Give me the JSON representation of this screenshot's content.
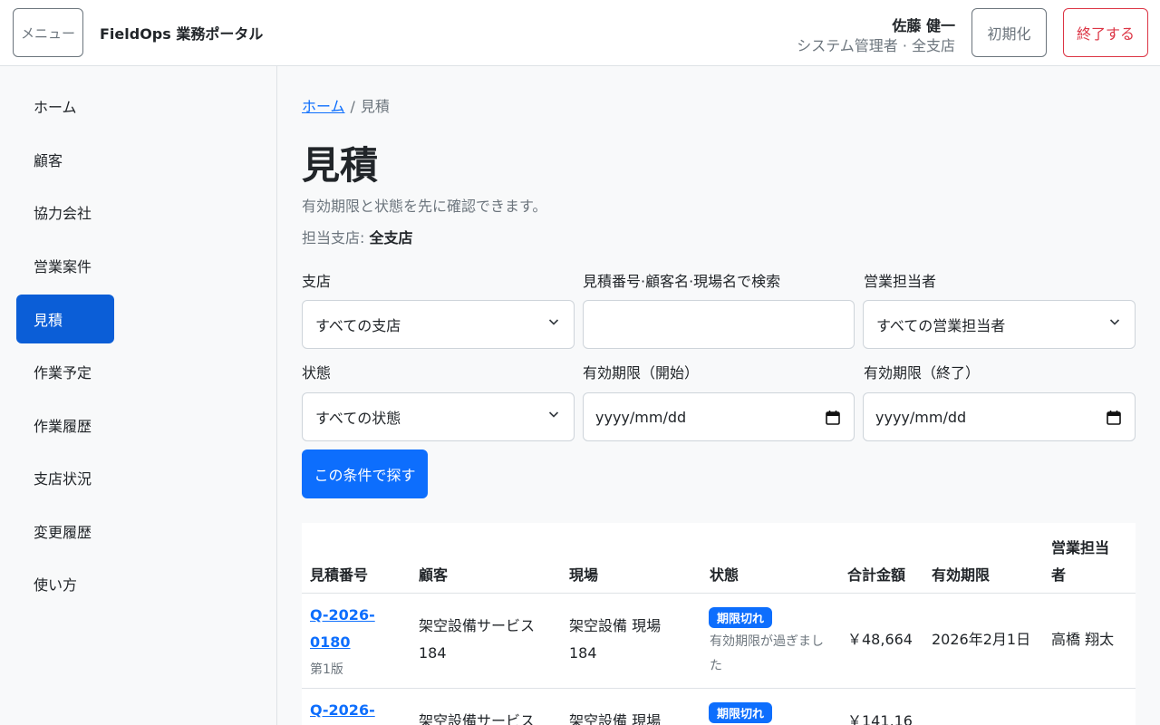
{
  "header": {
    "menu_label": "メニュー",
    "app_title": "FieldOps 業務ポータル",
    "user_name": "佐藤 健一",
    "user_role": "システム管理者 · 全支店",
    "reset_label": "初期化",
    "logout_label": "終了する"
  },
  "sidebar": {
    "items": [
      {
        "label": "ホーム"
      },
      {
        "label": "顧客"
      },
      {
        "label": "協力会社"
      },
      {
        "label": "営業案件"
      },
      {
        "label": "見積",
        "active": true
      },
      {
        "label": "作業予定"
      },
      {
        "label": "作業履歴"
      },
      {
        "label": "支店状況"
      },
      {
        "label": "変更履歴"
      },
      {
        "label": "使い方"
      }
    ]
  },
  "breadcrumb": {
    "home": "ホーム",
    "separator": "/",
    "current": "見積"
  },
  "page": {
    "title": "見積",
    "subtitle": "有効期限と状態を先に確認できます。",
    "branch_prefix": "担当支店:",
    "branch_value": "全支店"
  },
  "filters": {
    "branch_label": "支店",
    "branch_value": "すべての支店",
    "search_label": "見積番号·顧客名·現場名で検索",
    "search_value": "",
    "rep_label": "営業担当者",
    "rep_value": "すべての営業担当者",
    "status_label": "状態",
    "status_value": "すべての状態",
    "from_label": "有効期限（開始）",
    "from_placeholder": "yyyy/mm/dd",
    "to_label": "有効期限（終了）",
    "to_placeholder": "yyyy/mm/dd",
    "submit_label": "この条件で探す"
  },
  "table": {
    "headers": {
      "number": "見積番号",
      "customer": "顧客",
      "site": "現場",
      "status": "状態",
      "total": "合計金額",
      "expiry": "有効期限",
      "rep_line1": "営業担当",
      "rep_line2": "者"
    },
    "rows": [
      {
        "number_line1": "Q-2026-",
        "number_line2": "0180",
        "version": "第1版",
        "customer_line1": "架空設備サービス",
        "customer_line2": "184",
        "site_line1": "架空設備 現場",
        "site_line2": "184",
        "status_badge": "期限切れ",
        "status_note_line1": "有効期限が過ぎまし",
        "status_note_line2": "た",
        "total": "￥48,664",
        "expiry": "2026年2月1日",
        "rep": "高橋 翔太"
      },
      {
        "number_line1": "Q-2026-",
        "customer_line1": "架空設備サービス",
        "site_line1": "架空設備 現場",
        "status_badge": "期限切れ",
        "total": "￥141,16"
      }
    ]
  }
}
